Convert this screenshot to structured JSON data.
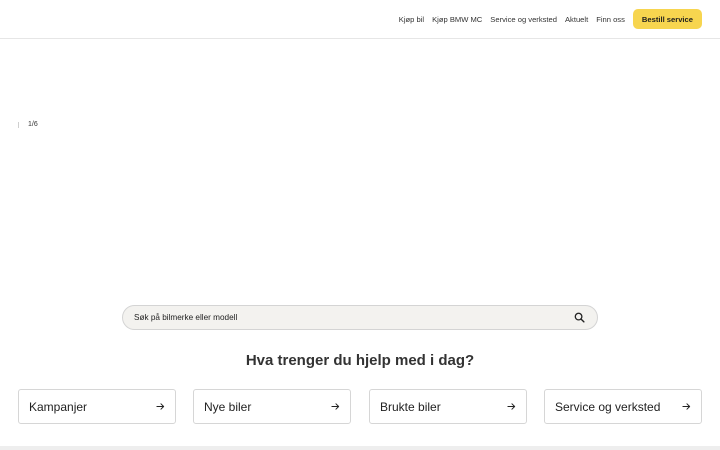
{
  "header": {
    "nav": [
      {
        "label": "Kjøp bil"
      },
      {
        "label": "Kjøp BMW MC"
      },
      {
        "label": "Service og verksted"
      },
      {
        "label": "Aktuelt"
      },
      {
        "label": "Finn oss"
      }
    ],
    "cta_label": "Bestill service",
    "cta_color": "#f7d54f"
  },
  "hero": {
    "slide_indicator": "1/6"
  },
  "search": {
    "placeholder": "Søk på bilmerke eller modell",
    "value": "",
    "icon": "search-icon"
  },
  "main": {
    "question": "Hva trenger du hjelp med i dag?",
    "cards": [
      {
        "label": "Kampanjer",
        "icon": "arrow-right-icon"
      },
      {
        "label": "Nye biler",
        "icon": "arrow-right-icon"
      },
      {
        "label": "Brukte biler",
        "icon": "arrow-right-icon"
      },
      {
        "label": "Service og verksted",
        "icon": "arrow-right-icon"
      }
    ]
  }
}
